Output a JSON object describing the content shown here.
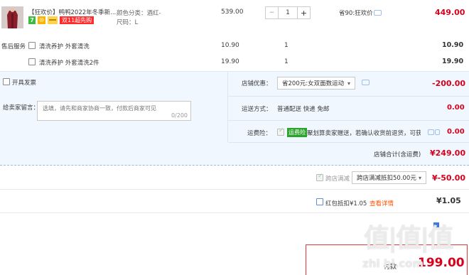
{
  "item": {
    "title": "【狂欢价】鸭鸭2022年冬季新...",
    "color_label": "颜色分类：酒红-",
    "size_label": "尺码：L",
    "badge1": "7",
    "badge2": "⑩",
    "badge3": "双11超先购",
    "unit_price": "539.00",
    "quantity": "1",
    "discount": "省90:狂欢价",
    "subtotal": "449.00"
  },
  "service": {
    "label": "售后服务",
    "rows": [
      {
        "name": "清洗养护 外套清洗",
        "price": "10.90",
        "qty": "1",
        "total": "10.90"
      },
      {
        "name": "清洗养护 外套清洗2件",
        "price": "19.90",
        "qty": "1",
        "total": "19.90"
      }
    ]
  },
  "invoice": {
    "label": "开具发票"
  },
  "store_coupon": {
    "label": "店铺优惠：",
    "selected": "省200元:女双面数运动",
    "amount": "-200.00"
  },
  "message": {
    "label": "给卖家留言：",
    "placeholder": "选填，请先和商家协商一致，付款后商家可见",
    "counter": "0/200"
  },
  "shipping": {
    "label": "运送方式：",
    "method": "普通配送 快递 免邮",
    "amount": "0.00"
  },
  "insurance": {
    "label": "运费险：",
    "tag": "运费险",
    "desc": "聚划算卖家赠送，若确认收货前退货，可获...",
    "amount": "0.00"
  },
  "store_total": {
    "label": "店铺合计(含运费)",
    "amount": "¥249.00"
  },
  "cross_store": {
    "label": "跨店满减",
    "selected": "跨店满减抵扣50.00元",
    "amount": "¥-50.00"
  },
  "redpacket": {
    "label": "红包抵扣¥1.05",
    "link": "查看详情",
    "amount": "¥1.05"
  },
  "bottom": {
    "partial_label": "付款",
    "price": "199.00",
    "watermark": "值|值|值",
    "watermark_url": "zhi hi.com"
  },
  "colors": {
    "band": "#f0f7ff",
    "red": "#d9001b",
    "accent": "#ff5000"
  }
}
